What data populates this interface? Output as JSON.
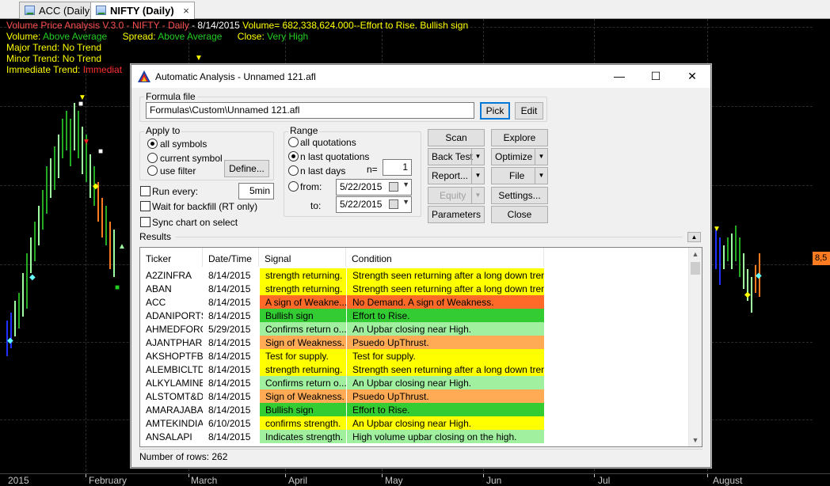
{
  "tabs": [
    {
      "label": "ACC (Daily)",
      "active": false
    },
    {
      "label": "NIFTY (Daily)",
      "active": true
    }
  ],
  "tab_close": "×",
  "chart": {
    "header_line1": {
      "prefix": "Volume Price Analysis V.3.0 - NIFTY - Daily",
      "date": "  - 8/14/2015",
      "volume": "  Volume= 682,338,624.000--",
      "signal": "Effort to Rise. Bullish sign"
    },
    "header_line2": {
      "volume_label": "Volume:",
      "volume_value": "Above Average",
      "spread_label": "Spread:",
      "spread_value": "Above Average",
      "close_label": "Close:",
      "close_value": "Very High"
    },
    "major_trend": "Major Trend:  No Trend",
    "minor_trend": "Minor Trend:  No Trend",
    "immediate_trend_label": "Immediate Trend:",
    "immediate_trend_value": "Immediat",
    "price_tag": "8,5",
    "x_labels": [
      "2015",
      "February",
      "March",
      "April",
      "May",
      "Jun",
      "Jul",
      "August"
    ]
  },
  "dialog": {
    "title": "Automatic Analysis - Unnamed 121.afl",
    "min": "—",
    "max": "☐",
    "close": "✕",
    "formula_group": "Formula file",
    "formula_path": "Formulas\\Custom\\Unnamed 121.afl",
    "pick": "Pick",
    "edit": "Edit",
    "apply_group": "Apply to",
    "apply_options": [
      "all symbols",
      "current symbol",
      "use filter"
    ],
    "define": "Define...",
    "range_group": "Range",
    "range_options": [
      "all quotations",
      "n last quotations",
      "n last days",
      "from:"
    ],
    "n_label": "n=",
    "n_value": "1",
    "from_date": "5/22/2015",
    "to_label": "to:",
    "to_date": "5/22/2015",
    "run_every": "Run every:",
    "run_every_value": "5min",
    "wait_backfill": "Wait for backfill (RT only)",
    "sync_chart": "Sync chart on select",
    "buttons": {
      "scan": "Scan",
      "explore": "Explore",
      "backtest": "Back Test",
      "optimize": "Optimize",
      "report": "Report...",
      "file": "File",
      "equity": "Equity",
      "settings": "Settings...",
      "parameters": "Parameters",
      "close": "Close"
    },
    "results_label": "Results",
    "columns": [
      "Ticker",
      "Date/Time",
      "Signal",
      "Condition"
    ],
    "rows": [
      {
        "ticker": "A2ZINFRA",
        "date": "8/14/2015",
        "signal": "strength returning.",
        "condition": "Strength seen returning after a long down tren...",
        "color": "#ffff00"
      },
      {
        "ticker": "ABAN",
        "date": "8/14/2015",
        "signal": "strength returning.",
        "condition": "Strength seen returning after a long down tren...",
        "color": "#ffff00"
      },
      {
        "ticker": "ACC",
        "date": "8/14/2015",
        "signal": "A sign of Weakne...",
        "condition": "No Demand. A sign of Weakness.",
        "color": "#ff6a28"
      },
      {
        "ticker": "ADANIPORTS",
        "date": "8/14/2015",
        "signal": "Bullish sign",
        "condition": "Effort to Rise.",
        "color": "#33cc33"
      },
      {
        "ticker": "AHMEDFORGE",
        "date": "5/29/2015",
        "signal": "Confirms return o...",
        "condition": "An Upbar closing near High.",
        "color": "#a0f0a0"
      },
      {
        "ticker": "AJANTPHARM",
        "date": "8/14/2015",
        "signal": "Sign of Weakness.",
        "condition": "Psuedo UpThrust.",
        "color": "#ffaa55"
      },
      {
        "ticker": "AKSHOPTFBR",
        "date": "8/14/2015",
        "signal": "Test for supply.",
        "condition": "Test for supply.",
        "color": "#ffff00"
      },
      {
        "ticker": "ALEMBICLTD",
        "date": "8/14/2015",
        "signal": "strength returning.",
        "condition": "Strength seen returning after a long down tren...",
        "color": "#ffff00"
      },
      {
        "ticker": "ALKYLAMINE",
        "date": "8/14/2015",
        "signal": "Confirms return o...",
        "condition": "An Upbar closing near High.",
        "color": "#a0f0a0"
      },
      {
        "ticker": "ALSTOMT&D",
        "date": "8/14/2015",
        "signal": "Sign of Weakness.",
        "condition": "Psuedo UpThrust.",
        "color": "#ffaa55"
      },
      {
        "ticker": "AMARAJABAT",
        "date": "8/14/2015",
        "signal": "Bullish sign",
        "condition": "Effort to Rise.",
        "color": "#33cc33"
      },
      {
        "ticker": "AMTEKINDIA",
        "date": "6/10/2015",
        "signal": "confirms strength.",
        "condition": "An Upbar closing near High.",
        "color": "#ffff00"
      },
      {
        "ticker": "ANSALAPI",
        "date": "8/14/2015",
        "signal": "Indicates strength.",
        "condition": "High volume upbar closing on the high.",
        "color": "#a0f0a0"
      }
    ],
    "status": "Number of rows: 262"
  }
}
